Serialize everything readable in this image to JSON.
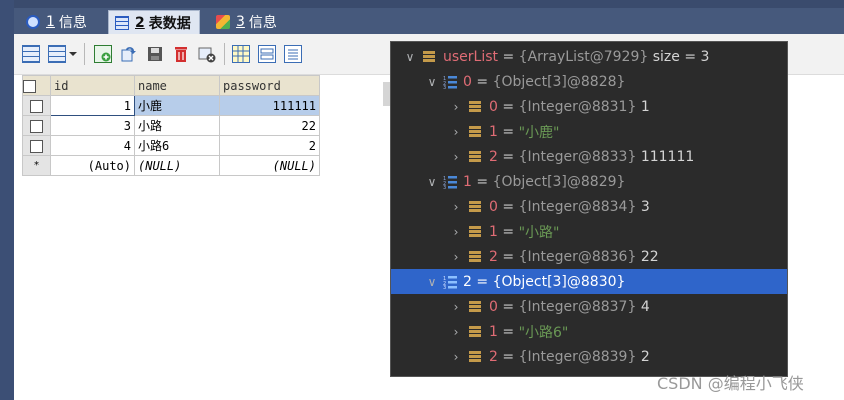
{
  "tabs": [
    {
      "num": "1",
      "label": "信息",
      "active": false
    },
    {
      "num": "2",
      "label": "表数据",
      "active": true
    },
    {
      "num": "3",
      "label": "信息",
      "active": false
    }
  ],
  "table": {
    "columns": [
      "id",
      "name",
      "password"
    ],
    "rows": [
      {
        "marker": "",
        "id": "1",
        "name": "小鹿",
        "password": "111111"
      },
      {
        "marker": "",
        "id": "3",
        "name": "小路",
        "password": "22"
      },
      {
        "marker": "",
        "id": "4",
        "name": "小路6",
        "password": "2"
      },
      {
        "marker": "*",
        "id": "(Auto)",
        "name": "(NULL)",
        "password": "(NULL)"
      }
    ]
  },
  "debugger": {
    "root": {
      "name": "userList",
      "type": "{ArrayList@7929}",
      "size": "size = 3"
    },
    "items": [
      {
        "index": "0",
        "type": "{Object[3]@8828}",
        "children": [
          {
            "index": "0",
            "type": "{Integer@8831}",
            "value": "1"
          },
          {
            "index": "1",
            "type": "",
            "value": "\"小鹿\""
          },
          {
            "index": "2",
            "type": "{Integer@8833}",
            "value": "111111"
          }
        ]
      },
      {
        "index": "1",
        "type": "{Object[3]@8829}",
        "children": [
          {
            "index": "0",
            "type": "{Integer@8834}",
            "value": "3"
          },
          {
            "index": "1",
            "type": "",
            "value": "\"小路\""
          },
          {
            "index": "2",
            "type": "{Integer@8836}",
            "value": "22"
          }
        ]
      },
      {
        "index": "2",
        "type": "{Object[3]@8830}",
        "children": [
          {
            "index": "0",
            "type": "{Integer@8837}",
            "value": "4"
          },
          {
            "index": "1",
            "type": "",
            "value": "\"小路6\""
          },
          {
            "index": "2",
            "type": "{Integer@8839}",
            "value": "2"
          }
        ]
      }
    ]
  },
  "watermark": "CSDN @编程小飞侠",
  "colors": {
    "selected_row": "#2f65ca",
    "field_icon": "#c49a4a",
    "name": "#e06c75",
    "string": "#6a9955"
  }
}
